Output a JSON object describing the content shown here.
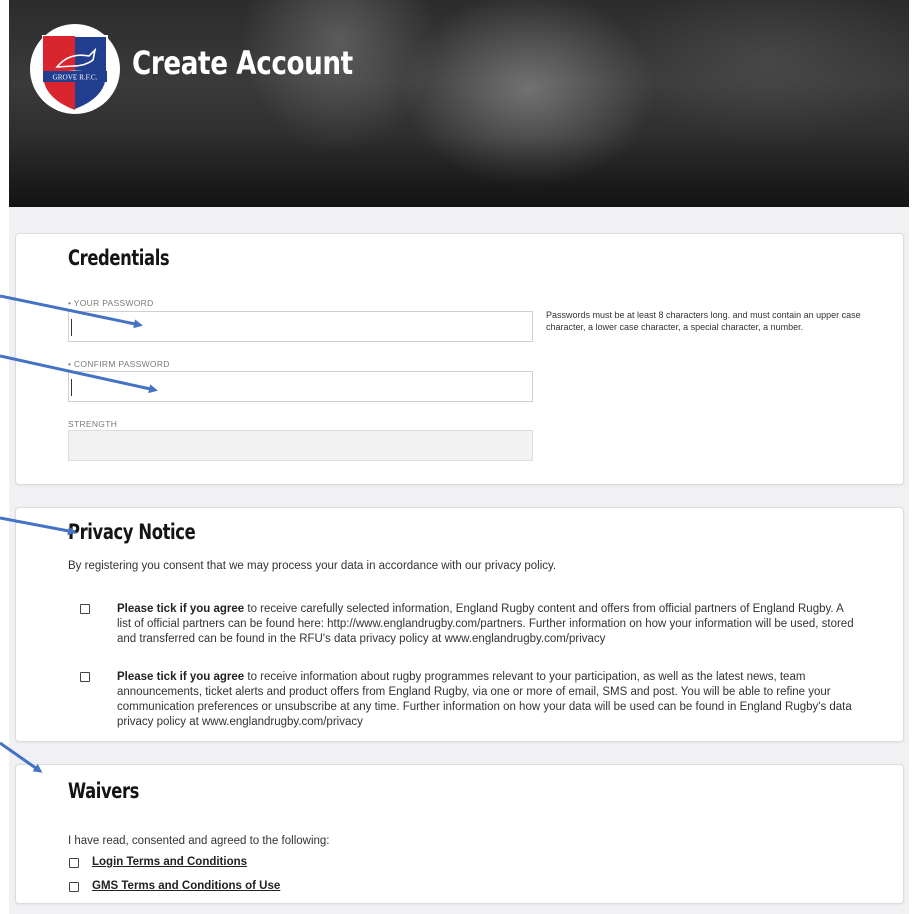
{
  "header": {
    "title": "Create Account",
    "logo_text": "GROVE R.F.C."
  },
  "credentials": {
    "title": "Credentials",
    "password_label": "• YOUR PASSWORD",
    "confirm_label": "• CONFIRM PASSWORD",
    "strength_label": "STRENGTH",
    "password_value": "",
    "confirm_value": "",
    "help_text": "Passwords must be at least 8 characters long. and must contain an upper case character, a lower case character, a special character, a number."
  },
  "privacy": {
    "title": "Privacy Notice",
    "intro": "By registering you consent that we may process your data in accordance with our privacy policy.",
    "consent_1_bold": "Please tick if you agree",
    "consent_1_text": " to receive carefully selected information, England Rugby content and offers from official partners of England Rugby. A list of official partners can be found here: http://www.englandrugby.com/partners. Further information on how your information will be used, stored and transferred can be found in the RFU's data privacy policy at www.englandrugby.com/privacy",
    "consent_2_bold": "Please tick if you agree",
    "consent_2_text": " to receive information about rugby programmes relevant to your participation, as well as the latest news, team announcements, ticket alerts and product offers from England Rugby, via one or more of email, SMS and post. You will be able to refine your communication preferences or unsubscribe at any time. Further information on how your data will be used can be found in England Rugby's data privacy policy at www.englandrugby.com/privacy"
  },
  "waivers": {
    "title": "Waivers",
    "intro": "I have read, consented and agreed to the following:",
    "items": [
      {
        "label": "Login Terms and Conditions"
      },
      {
        "label": "GMS Terms and Conditions of Use"
      }
    ]
  },
  "colors": {
    "arrow": "#4472c4",
    "logo_red": "#d8252e",
    "logo_blue": "#223e8f"
  }
}
